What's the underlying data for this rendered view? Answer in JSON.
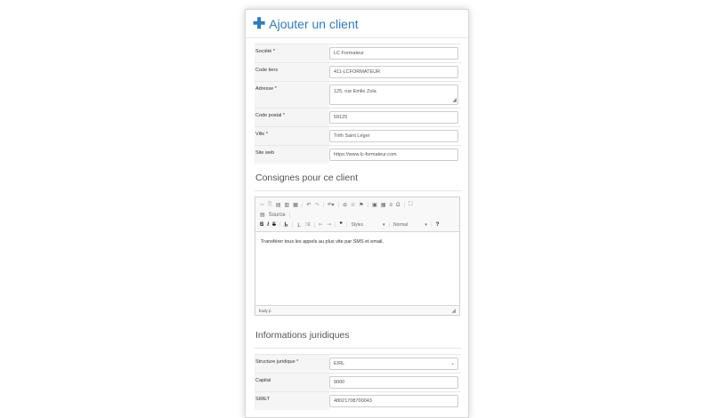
{
  "header": {
    "title": "Ajouter un client"
  },
  "fields": [
    {
      "label": "Société *",
      "value": "LC Formateur"
    },
    {
      "label": "Code tiers",
      "value": "411-LCFORMATEUR"
    },
    {
      "label": "Adresse *",
      "value": "125, rue Emile Zola"
    },
    {
      "label": "Code postal *",
      "value": "59125"
    },
    {
      "label": "Ville *",
      "value": "Trith Saint Léger"
    },
    {
      "label": "Site web",
      "value": "https://www.lc-formateur.com"
    }
  ],
  "consignes": {
    "title": "Consignes pour ce client",
    "source_label": "Source",
    "styles_label": "Styles",
    "format_label": "Normal",
    "content": "Transférer tous les appels au plus vite par SMS et email.",
    "path": "body  p"
  },
  "juridique": {
    "title": "Informations juridiques",
    "fields": [
      {
        "label": "Structure juridique *",
        "value": "EIRL"
      },
      {
        "label": "Capital",
        "value": "9000"
      },
      {
        "label": "SIRET",
        "value": "48021708700043"
      }
    ]
  }
}
